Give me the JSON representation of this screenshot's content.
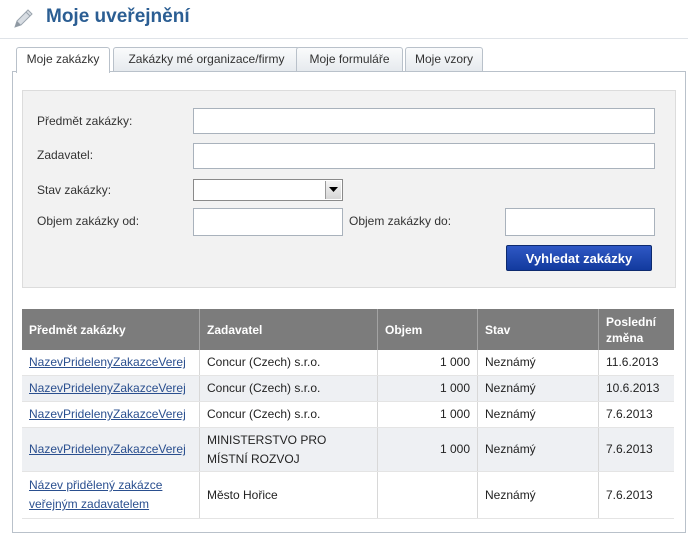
{
  "header": {
    "title": "Moje uveřejnění",
    "icon": "pencil-icon"
  },
  "tabs": [
    {
      "label": "Moje zakázky",
      "active": true
    },
    {
      "label": "Zakázky mé organizace/firmy",
      "active": false
    },
    {
      "label": "Moje formuláře",
      "active": false
    },
    {
      "label": "Moje vzory",
      "active": false
    }
  ],
  "form": {
    "subject_label": "Předmět zakázky:",
    "subject_value": "",
    "contracting_label": "Zadavatel:",
    "contracting_value": "",
    "status_label": "Stav zakázky:",
    "status_value": "",
    "volume_from_label": "Objem zakázky od:",
    "volume_from_value": "",
    "volume_to_label": "Objem zakázky do:",
    "volume_to_value": "",
    "search_button": "Vyhledat zakázky"
  },
  "table": {
    "headers": [
      "Předmět zakázky",
      "Zadavatel",
      "Objem",
      "Stav",
      "Poslední změna"
    ],
    "rows": [
      {
        "subject": "NazevPridelenyZakazceVerejnymZadavatelem",
        "contracting": "Concur (Czech) s.r.o.",
        "volume": "1 000",
        "status": "Neznámý",
        "changed": "11.6.2013"
      },
      {
        "subject": "NazevPridelenyZakazceVerejnymZadavatelem",
        "contracting": "Concur (Czech) s.r.o.",
        "volume": "1 000",
        "status": "Neznámý",
        "changed": "10.6.2013"
      },
      {
        "subject": "NazevPridelenyZakazceVerejnymZadavatelem",
        "contracting": "Concur (Czech) s.r.o.",
        "volume": "1 000",
        "status": "Neznámý",
        "changed": "7.6.2013"
      },
      {
        "subject": "NazevPridelenyZakazceVerejnymZadavatelem",
        "contracting": "MINISTERSTVO PRO MÍSTNÍ ROZVOJ",
        "volume": "1 000",
        "status": "Neznámý",
        "changed": "7.6.2013"
      },
      {
        "subject": "Název přidělený zakázce veřejným zadavatelem",
        "contracting": "Město Hořice",
        "volume": "",
        "status": "Neznámý",
        "changed": "7.6.2013"
      }
    ]
  },
  "colors": {
    "title": "#2b5e93",
    "header_bg": "#7c7c7c",
    "button": "#1b43ad",
    "link": "#2a4f8f"
  }
}
